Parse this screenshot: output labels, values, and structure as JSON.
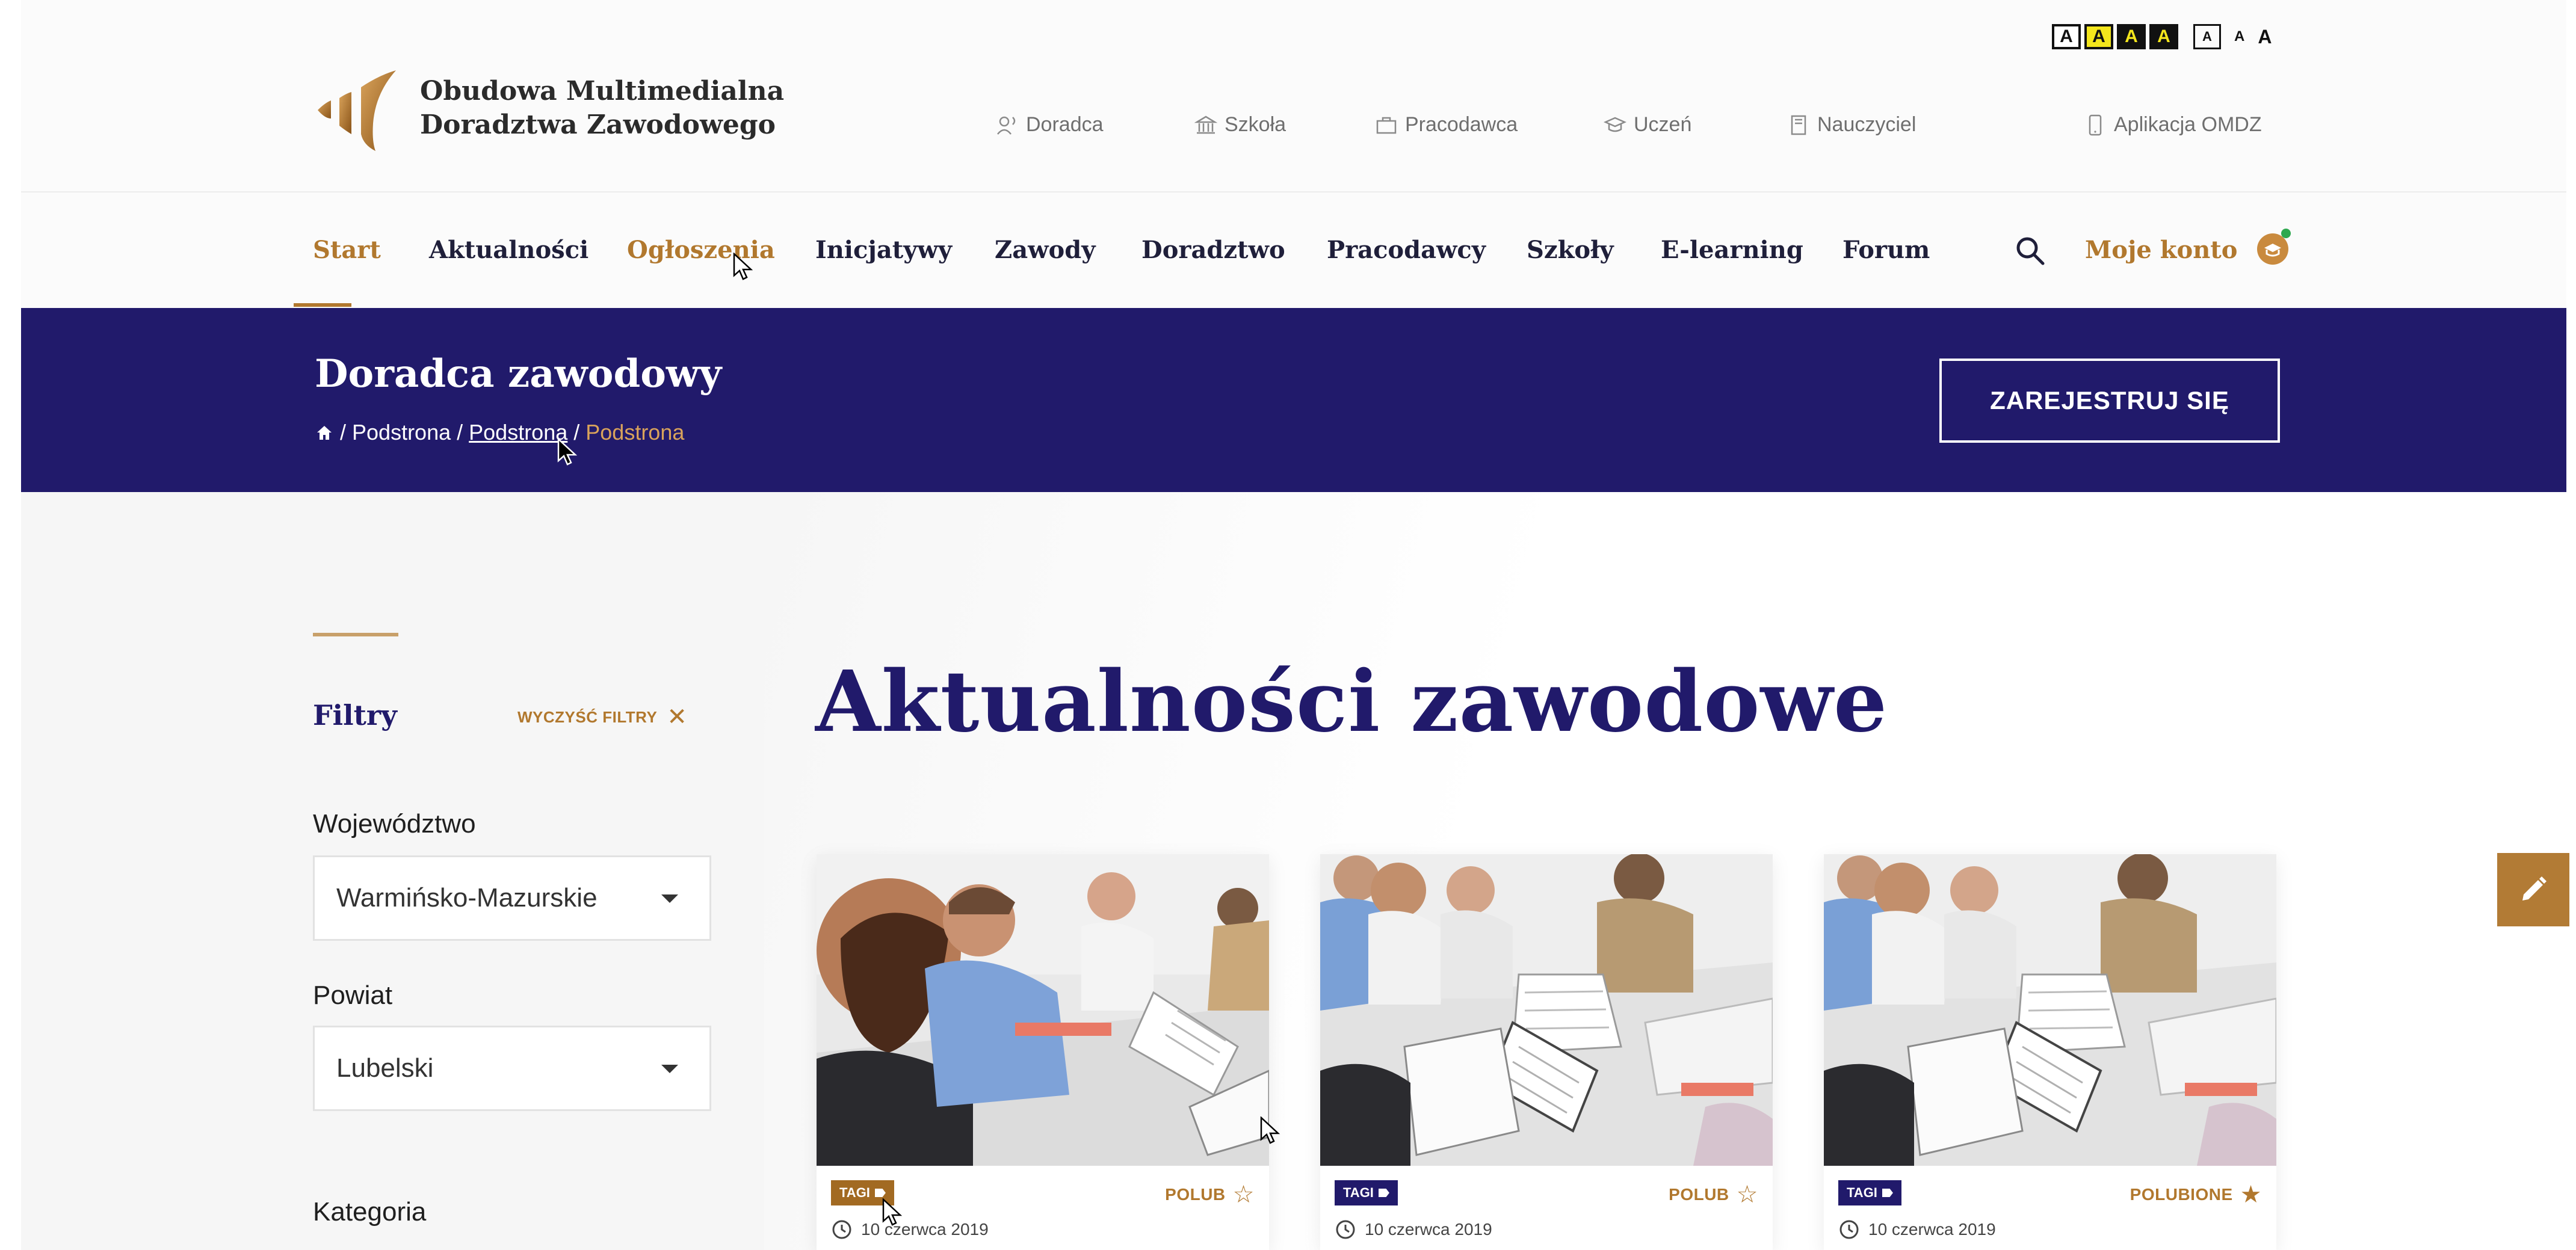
{
  "accessibility": {
    "contrast_options": [
      {
        "label": "A",
        "style": "white"
      },
      {
        "label": "A",
        "style": "yellow"
      },
      {
        "label": "A",
        "style": "black"
      },
      {
        "label": "A",
        "style": "black"
      }
    ],
    "font_sizes": [
      "A",
      "A",
      "A"
    ]
  },
  "logo": {
    "line1": "Obudowa Multimedialna",
    "line2": "Doradztwa Zawodowego"
  },
  "audience_nav": [
    "Doradca",
    "Szkoła",
    "Pracodawca",
    "Uczeń",
    "Nauczyciel",
    "Aplikacja OMDZ"
  ],
  "main_nav": {
    "items": [
      "Start",
      "Aktualności",
      "Ogłoszenia",
      "Inicjatywy",
      "Zawody",
      "Doradztwo",
      "Pracodawcy",
      "Szkoły",
      "E-learning",
      "Forum"
    ],
    "active": "Start",
    "account_label": "Moje konto"
  },
  "banner": {
    "title": "Doradca zawodowy",
    "breadcrumb": [
      "Podstrona",
      "Podstrona",
      "Podstrona"
    ],
    "register_label": "ZAREJESTRUJ SIĘ"
  },
  "filters": {
    "title": "Filtry",
    "clear_label": "WYCZYŚĆ FILTRY",
    "voivodeship_label": "Województwo",
    "voivodeship_value": "Warmińsko-Mazurskie",
    "county_label": "Powiat",
    "county_value": "Lubelski",
    "category_label": "Kategoria"
  },
  "page_title": "Aktualności zawodowe",
  "cards": [
    {
      "tag": "TAGI",
      "like_label": "POLUB",
      "liked": false,
      "date": "10 czerwca 2019"
    },
    {
      "tag": "TAGI",
      "like_label": "POLUB",
      "liked": false,
      "date": "10 czerwca 2019"
    },
    {
      "tag": "TAGI",
      "like_label": "POLUBIONE",
      "liked": true,
      "date": "10 czerwca 2019"
    }
  ],
  "colors": {
    "brand_navy": "#211a6b",
    "brand_gold": "#b1782e"
  }
}
